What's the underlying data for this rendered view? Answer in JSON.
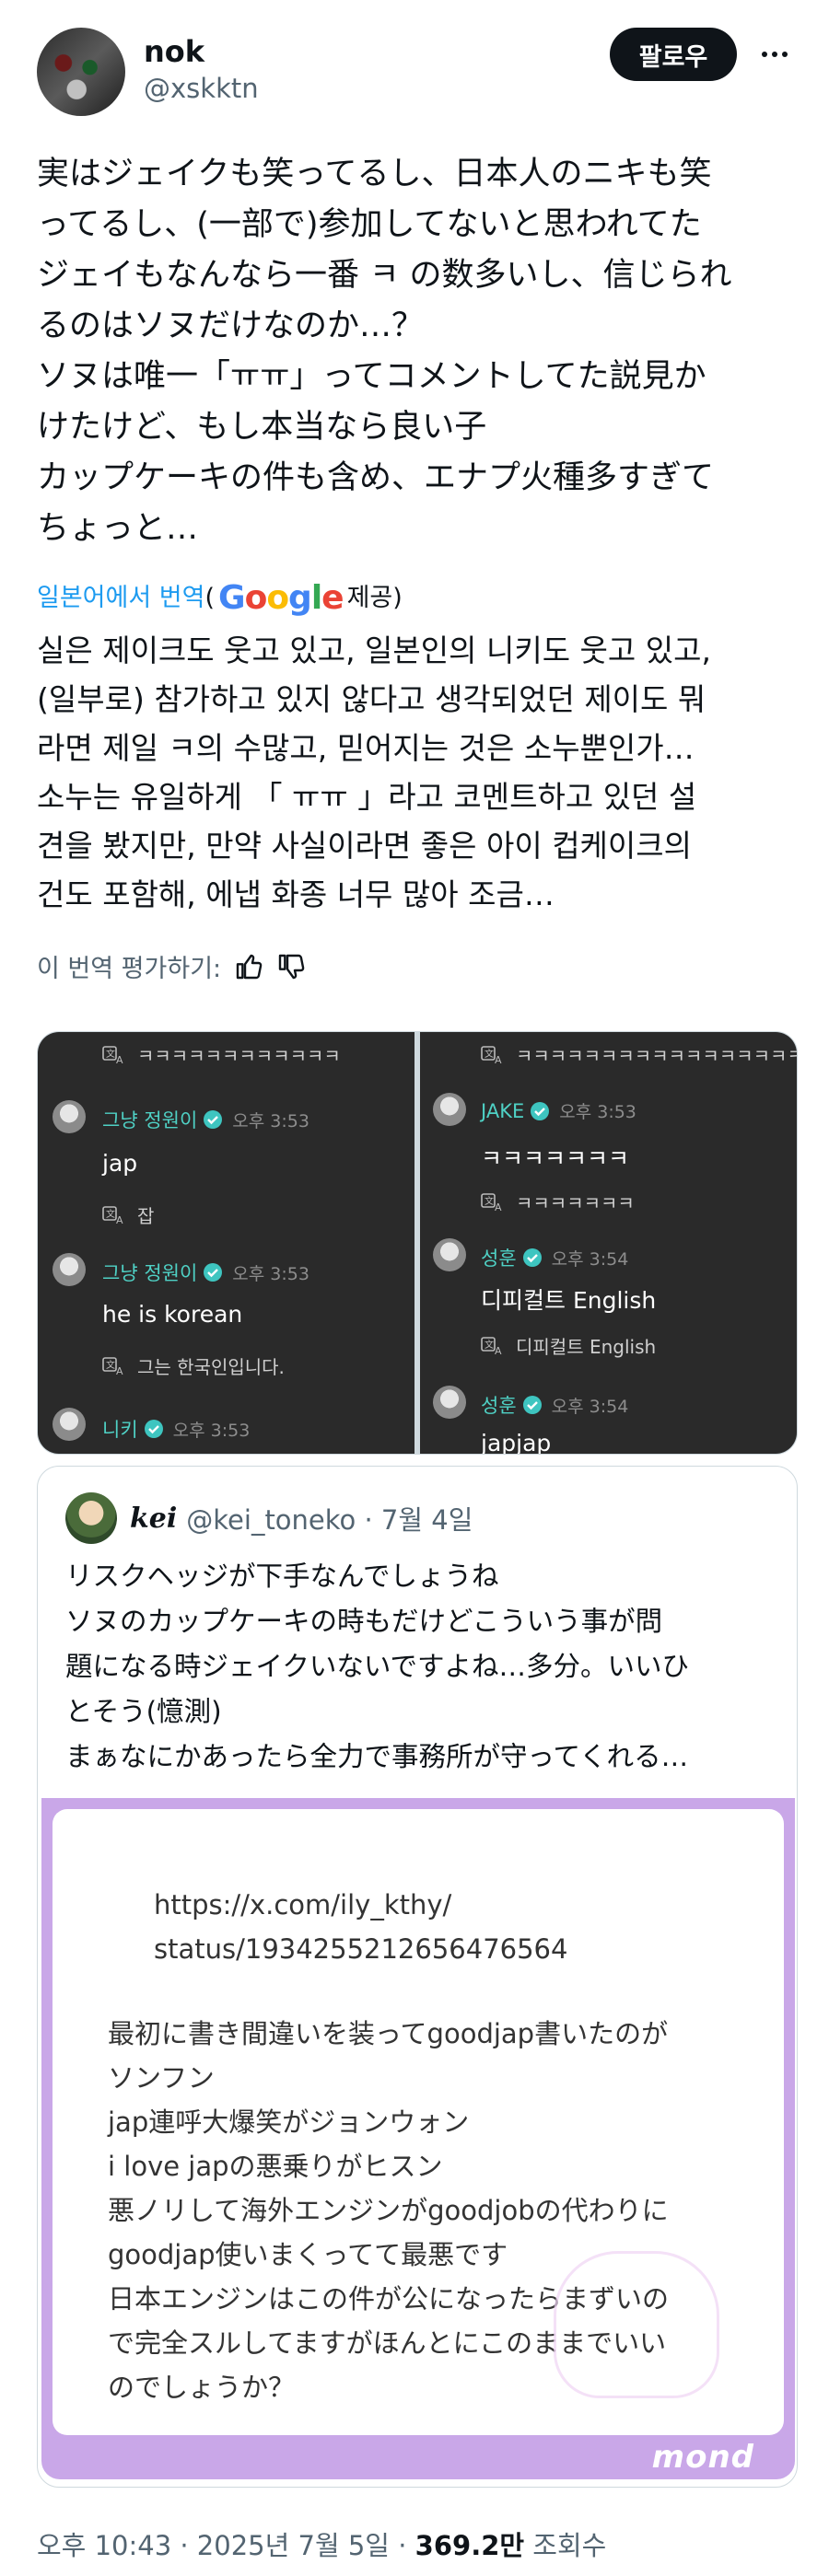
{
  "author": {
    "display_name": "nok",
    "handle": "@xskktn",
    "follow_label": "팔로우"
  },
  "tweet": {
    "lines": [
      "実はジェイクも笑ってるし、日本人のニキも笑",
      "ってるし、(一部で)参加してないと思われてた",
      "ジェイもなんなら一番 ㅋ の数多いし、信じられ",
      "るのはソヌだけなのか…？",
      "ソヌは唯一「ㅠㅠ」ってコメントしてた説見か",
      "けたけど、もし本当なら良い子",
      "カップケーキの件も含め、エナプ火種多すぎて",
      "ちょっと…"
    ]
  },
  "translation_bar": {
    "link_text": "일본어에서 번역",
    "open_paren": "(",
    "google_letters": [
      "G",
      "o",
      "o",
      "g",
      "l",
      "e"
    ],
    "suffix": "제공)"
  },
  "translation": {
    "lines": [
      "실은 제이크도 웃고 있고, 일본인의 니키도 웃고 있고,",
      "(일부로) 참가하고 있지 않다고 생각되었던 제이도 뭐",
      "라면 제일 ㅋ의 수많고, 믿어지는 것은 소누뿐인가…",
      "소누는 유일하게 「 ㅠㅠ 」라고 코멘트하고 있던 설",
      "견을 봤지만, 만약 사실이라면 좋은 아이 컵케이크의",
      "건도 포함해, 에냅 화종 너무 많아 조금…"
    ]
  },
  "rate": {
    "label": "이 번역 평가하기:"
  },
  "media": {
    "left": {
      "top_translation": "ㅋㅋㅋㅋㅋㅋㅋㅋㅋㅋㅋㅋ",
      "messages": [
        {
          "name": "그냥 정원이",
          "time": "오후 3:53",
          "body": "jap",
          "translation": "잡"
        },
        {
          "name": "그냥 정원이",
          "time": "오후 3:53",
          "body": "he is korean",
          "translation": "그는 한국인입니다."
        },
        {
          "name": "니키",
          "time": "오후 3:53"
        }
      ]
    },
    "right": {
      "top_translation": "ㅋㅋㅋㅋㅋㅋㅋㅋㅋㅋㅋㅋㅋㅋㅋㅋㅋ",
      "messages": [
        {
          "name": "JAKE",
          "time": "오후 3:53",
          "body": "ㅋㅋㅋㅋㅋㅋㅋ",
          "translation": "ㅋㅋㅋㅋㅋㅋㅋ"
        },
        {
          "name": "성훈",
          "time": "오후 3:54",
          "body": "디피컬트 English",
          "translation": "디피컬트 English"
        },
        {
          "name": "성훈",
          "time": "오후 3:54",
          "body": "japjap"
        }
      ]
    }
  },
  "quote": {
    "name": "kei",
    "meta": "@kei_toneko · 7월 4일",
    "lines": [
      "リスクヘッジが下手なんでしょうね",
      "ソヌのカップケーキの時もだけどこういう事が問",
      "題になる時ジェイクいないですよね…多分。いいひ",
      "とそう(憶測)",
      "まぁなにかあったら全力で事務所が守ってくれる…"
    ],
    "image": {
      "url_lines": [
        "https://x.com/ily_kthy/",
        "status/1934255212656476564"
      ],
      "body_lines": [
        "最初に書き間違いを装ってgoodjap書いたのが",
        "ソンフン",
        "jap連呼大爆笑がジョンウォン",
        "i love japの悪乗りがヒスン",
        "悪ノリして海外エンジンがgoodjobの代わりに",
        "goodjap使いまくってて最悪です",
        "日本エンジンはこの件が公になったらまずいの",
        "で完全スルしてますがほんとにこのままでいい",
        "のでしょうか？"
      ],
      "watermark": "mond"
    }
  },
  "footer": {
    "time": "오후 10:43 · 2025년 7월 5일 · ",
    "views": "369.2만",
    "views_suffix": " 조회수"
  }
}
